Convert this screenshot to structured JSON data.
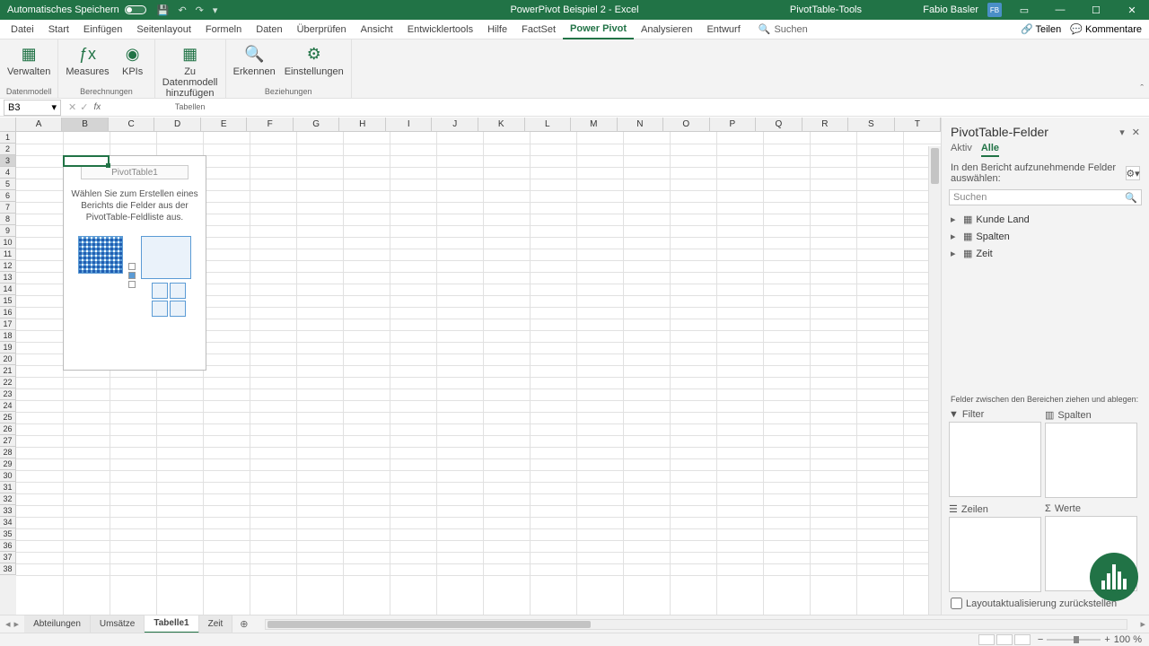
{
  "titlebar": {
    "autosave_label": "Automatisches Speichern",
    "doc_title": "PowerPivot Beispiel 2 - Excel",
    "tools_title": "PivotTable-Tools",
    "user_name": "Fabio Basler",
    "user_initials": "FB"
  },
  "tabs": {
    "items": [
      "Datei",
      "Start",
      "Einfügen",
      "Seitenlayout",
      "Formeln",
      "Daten",
      "Überprüfen",
      "Ansicht",
      "Entwicklertools",
      "Hilfe",
      "FactSet",
      "Power Pivot",
      "Analysieren",
      "Entwurf"
    ],
    "active": "Power Pivot",
    "search_label": "Suchen",
    "share_label": "Teilen",
    "comments_label": "Kommentare"
  },
  "ribbon": {
    "groups": [
      {
        "label": "Datenmodell",
        "buttons": [
          {
            "label": "Verwalten"
          }
        ]
      },
      {
        "label": "Berechnungen",
        "buttons": [
          {
            "label": "Measures"
          },
          {
            "label": "KPIs"
          }
        ]
      },
      {
        "label": "Tabellen",
        "buttons": [
          {
            "label": "Zu Datenmodell hinzufügen"
          }
        ]
      },
      {
        "label": "Beziehungen",
        "buttons": [
          {
            "label": "Erkennen"
          },
          {
            "label": "Einstellungen"
          }
        ]
      }
    ]
  },
  "namebox": {
    "value": "B3"
  },
  "columns": [
    "A",
    "B",
    "C",
    "D",
    "E",
    "F",
    "G",
    "H",
    "I",
    "J",
    "K",
    "L",
    "M",
    "N",
    "O",
    "P",
    "Q",
    "R",
    "S",
    "T"
  ],
  "rows_count": 38,
  "active_cell": {
    "col": 1,
    "row": 2
  },
  "pivot_placeholder": {
    "title": "PivotTable1",
    "hint": "Wählen Sie zum Erstellen eines Berichts die Felder aus der PivotTable-Feldliste aus."
  },
  "side_panel": {
    "title": "PivotTable-Felder",
    "tabs": [
      "Aktiv",
      "Alle"
    ],
    "active_tab": "Alle",
    "hint": "In den Bericht aufzunehmende Felder auswählen:",
    "search_placeholder": "Suchen",
    "fields": [
      "Kunde Land",
      "Spalten",
      "Zeit"
    ],
    "drag_hint": "Felder zwischen den Bereichen ziehen und ablegen:",
    "zones": {
      "filter": "Filter",
      "columns": "Spalten",
      "rows": "Zeilen",
      "values": "Werte"
    },
    "defer_label": "Layoutaktualisierung zurückstellen"
  },
  "sheet_tabs": {
    "items": [
      "Abteilungen",
      "Umsätze",
      "Tabelle1",
      "Zeit"
    ],
    "active": "Tabelle1"
  },
  "status": {
    "zoom": "100 %"
  }
}
